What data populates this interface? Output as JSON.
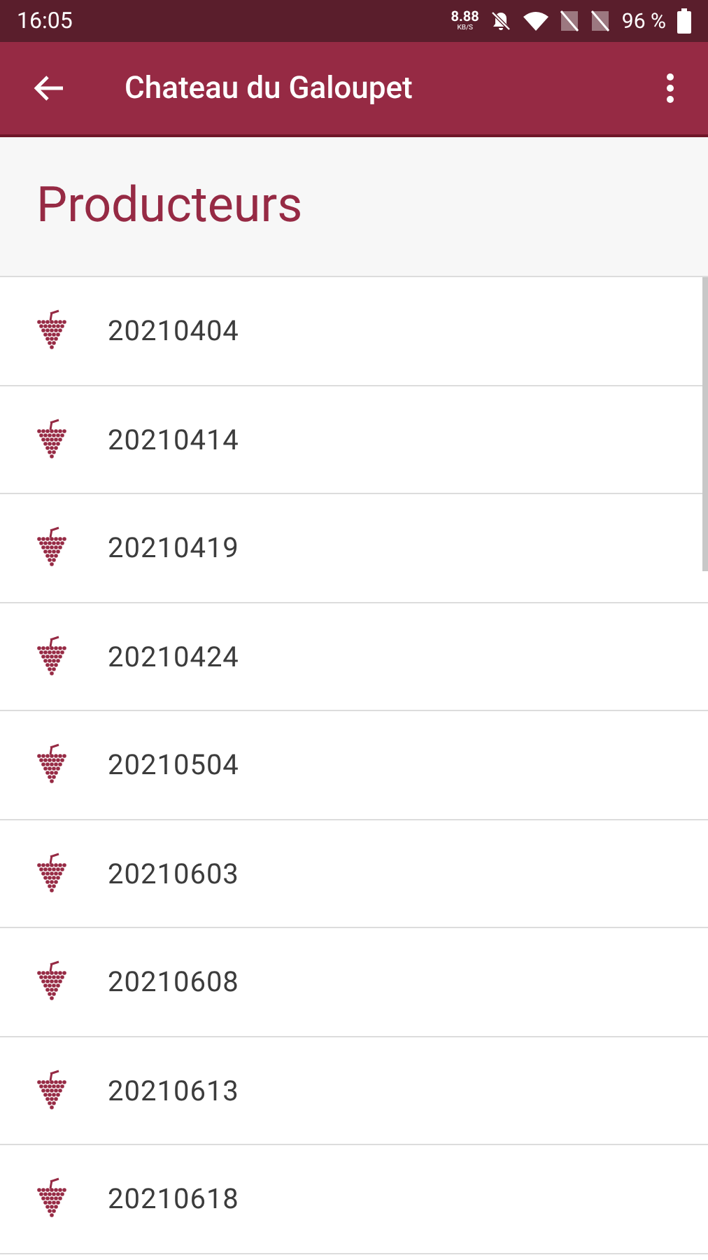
{
  "status_bar": {
    "time": "16:05",
    "speed": "8.88",
    "speed_unit": "KB/S",
    "battery": "96 %"
  },
  "app_bar": {
    "title": "Chateau du Galoupet"
  },
  "section": {
    "title": "Producteurs"
  },
  "items": [
    {
      "label": "20210404"
    },
    {
      "label": "20210414"
    },
    {
      "label": "20210419"
    },
    {
      "label": "20210424"
    },
    {
      "label": "20210504"
    },
    {
      "label": "20210603"
    },
    {
      "label": "20210608"
    },
    {
      "label": "20210613"
    },
    {
      "label": "20210618"
    }
  ]
}
